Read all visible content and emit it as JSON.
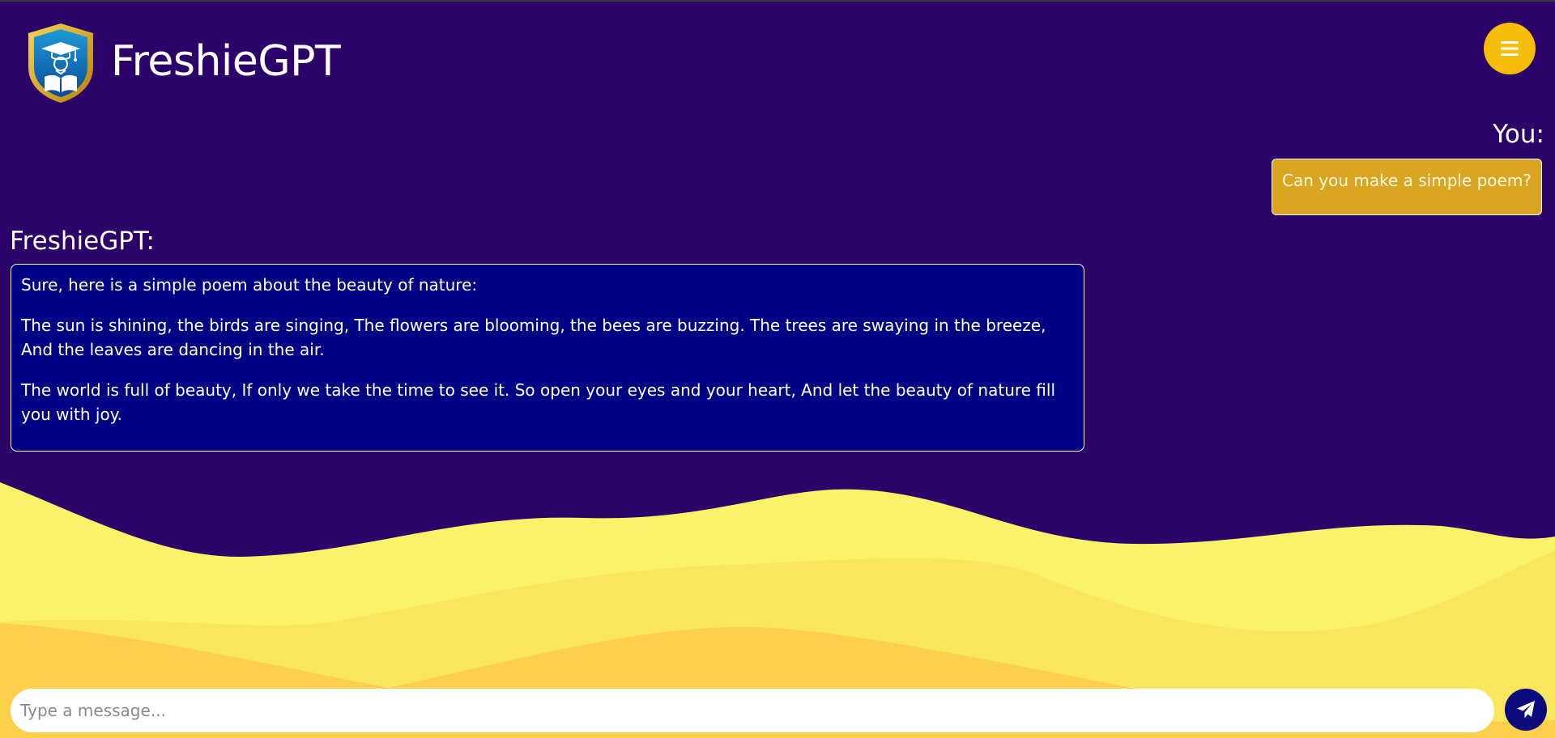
{
  "header": {
    "app_name": "FreshieGPT",
    "logo_icon": "graduation-shield-icon",
    "menu_icon": "hamburger-menu-icon"
  },
  "conversation": {
    "user_label": "You:",
    "user_message": "Can you make a simple poem?",
    "bot_label": "FreshieGPT:",
    "bot_paragraphs": [
      "Sure, here is a simple poem about the beauty of nature:",
      "The sun is shining, the birds are singing, The flowers are blooming, the bees are buzzing. The trees are swaying in the breeze, And the leaves are dancing in the air.",
      "The world is full of beauty, If only we take the time to see it. So open your eyes and your heart, And let the beauty of nature fill you with joy."
    ]
  },
  "composer": {
    "placeholder": "Type a message...",
    "value": "",
    "send_icon": "paper-plane-icon"
  },
  "colors": {
    "background": "#2c0369",
    "accent": "#f5bd0a",
    "user_bubble": "#daa520",
    "bot_bubble": "#000284",
    "send_button": "#0a0a7a"
  }
}
